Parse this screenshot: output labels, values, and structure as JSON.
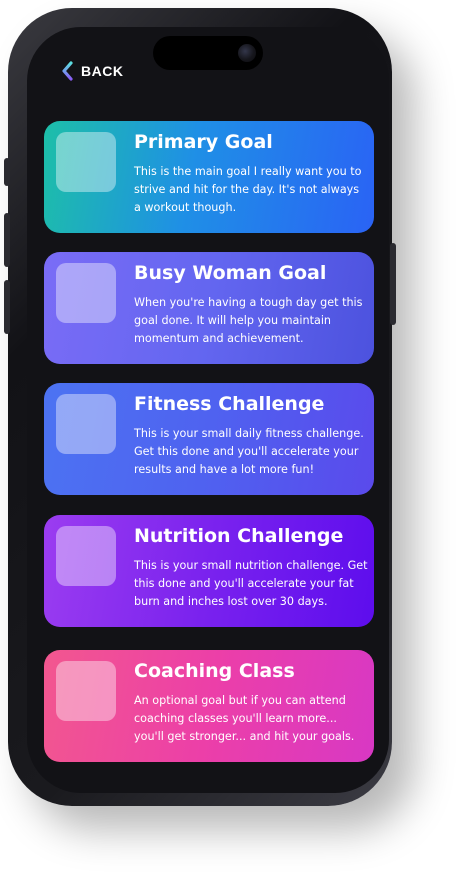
{
  "header": {
    "back_label": "BACK",
    "back_icon": "chevron-left-icon",
    "back_icon_colors": [
      "#5be0e0",
      "#8a5cf6"
    ]
  },
  "goals": [
    {
      "title": "Primary Goal",
      "description": "This is the main goal I really want you to strive and hit for the day. It's not always a workout though.",
      "checked": false,
      "colors": [
        "#1dbfa8",
        "#2a63f5"
      ]
    },
    {
      "title": "Busy Woman Goal",
      "description": "When you're having a tough day get this goal done. It will help you maintain momentum and achievement.",
      "checked": false,
      "colors": [
        "#7a6cf6",
        "#4c52de"
      ]
    },
    {
      "title": "Fitness Challenge",
      "description": "This is your small daily fitness challenge. Get this done and you'll accelerate your results and have a lot more fun!",
      "checked": false,
      "colors": [
        "#4c73f2",
        "#5a4aec"
      ]
    },
    {
      "title": "Nutrition Challenge",
      "description": "This is your small nutrition challenge. Get this done and you'll accelerate your fat burn and inches lost over 30 days.",
      "checked": false,
      "colors": [
        "#9b3df0",
        "#5d0ded"
      ]
    },
    {
      "title": "Coaching Class",
      "description": "An optional goal but if you can attend coaching classes you'll learn more... you'll get stronger... and hit your goals.",
      "checked": false,
      "colors": [
        "#f2578f",
        "#d838c4"
      ]
    }
  ]
}
